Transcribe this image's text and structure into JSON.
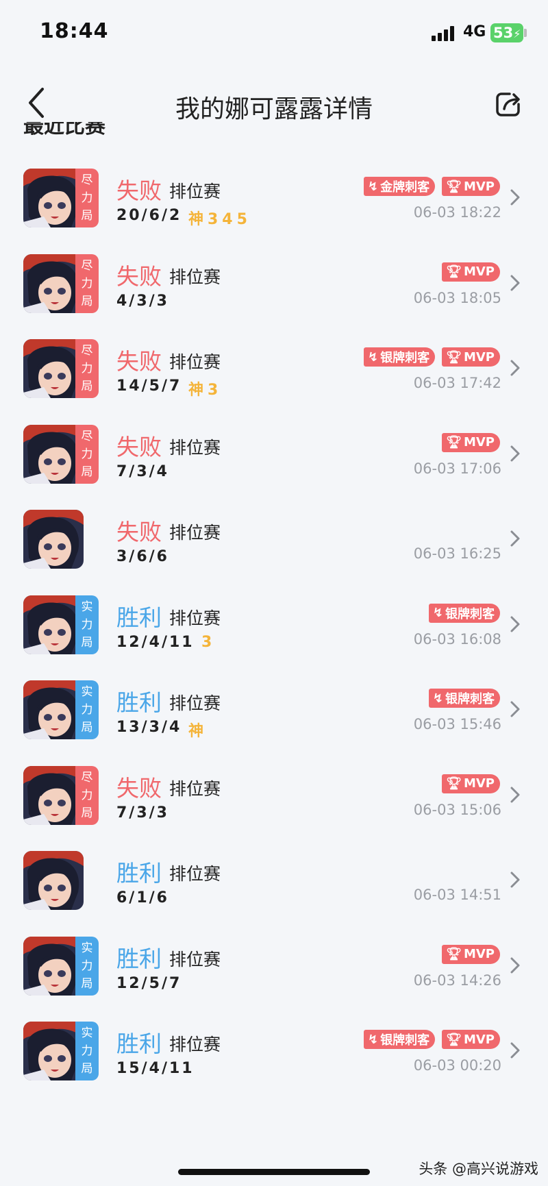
{
  "status_bar": {
    "time": "18:44",
    "network": "4G",
    "battery": "53"
  },
  "header": {
    "title": "我的娜可露露详情"
  },
  "section": {
    "title": "最近比赛"
  },
  "matches": [
    {
      "mode": "尽力局",
      "mode_color": "red",
      "result": "失败",
      "outcome": "loss",
      "type": "排位赛",
      "kda": "20/6/2",
      "honors": "神345",
      "badges": [
        "金牌刺客",
        "MVP"
      ],
      "time": "06-03 18:22"
    },
    {
      "mode": "尽力局",
      "mode_color": "red",
      "result": "失败",
      "outcome": "loss",
      "type": "排位赛",
      "kda": "4/3/3",
      "honors": "",
      "badges": [
        "MVP"
      ],
      "time": "06-03 18:05"
    },
    {
      "mode": "尽力局",
      "mode_color": "red",
      "result": "失败",
      "outcome": "loss",
      "type": "排位赛",
      "kda": "14/5/7",
      "honors": "神3",
      "badges": [
        "银牌刺客",
        "MVP"
      ],
      "time": "06-03 17:42"
    },
    {
      "mode": "尽力局",
      "mode_color": "red",
      "result": "失败",
      "outcome": "loss",
      "type": "排位赛",
      "kda": "7/3/4",
      "honors": "",
      "badges": [
        "MVP"
      ],
      "time": "06-03 17:06"
    },
    {
      "mode": "",
      "mode_color": "",
      "result": "失败",
      "outcome": "loss",
      "type": "排位赛",
      "kda": "3/6/6",
      "honors": "",
      "badges": [],
      "time": "06-03 16:25"
    },
    {
      "mode": "实力局",
      "mode_color": "blue",
      "result": "胜利",
      "outcome": "win",
      "type": "排位赛",
      "kda": "12/4/11",
      "honors": "3",
      "badges": [
        "银牌刺客"
      ],
      "time": "06-03 16:08"
    },
    {
      "mode": "实力局",
      "mode_color": "blue",
      "result": "胜利",
      "outcome": "win",
      "type": "排位赛",
      "kda": "13/3/4",
      "honors": "神",
      "badges": [
        "银牌刺客"
      ],
      "time": "06-03 15:46"
    },
    {
      "mode": "尽力局",
      "mode_color": "red",
      "result": "失败",
      "outcome": "loss",
      "type": "排位赛",
      "kda": "7/3/3",
      "honors": "",
      "badges": [
        "MVP"
      ],
      "time": "06-03 15:06"
    },
    {
      "mode": "",
      "mode_color": "",
      "result": "胜利",
      "outcome": "win",
      "type": "排位赛",
      "kda": "6/1/6",
      "honors": "",
      "badges": [],
      "time": "06-03 14:51"
    },
    {
      "mode": "实力局",
      "mode_color": "blue",
      "result": "胜利",
      "outcome": "win",
      "type": "排位赛",
      "kda": "12/5/7",
      "honors": "",
      "badges": [
        "MVP"
      ],
      "time": "06-03 14:26"
    },
    {
      "mode": "实力局",
      "mode_color": "blue",
      "result": "胜利",
      "outcome": "win",
      "type": "排位赛",
      "kda": "15/4/11",
      "honors": "",
      "badges": [
        "银牌刺客",
        "MVP"
      ],
      "time": "06-03 00:20"
    }
  ],
  "watermark": "头条 @高兴说游戏",
  "icons": {
    "back": "chevron-left-icon",
    "share": "share-icon",
    "row_arrow": "chevron-right-icon",
    "mvp": "trophy-icon",
    "assassin": "flame-icon"
  },
  "colors": {
    "loss": "#f0686c",
    "win": "#4aa6e8",
    "honor": "#f4b43a",
    "badge": "#f0686c"
  }
}
